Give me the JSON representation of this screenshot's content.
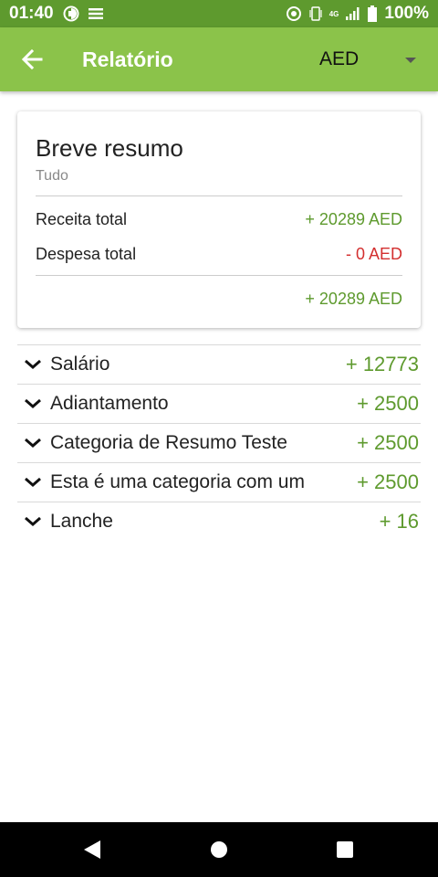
{
  "status_bar": {
    "time": "01:40",
    "battery": "100%",
    "network": "4G",
    "icons": [
      "sim-icon",
      "notification-list-icon",
      "sync-icon",
      "vibrate-icon",
      "signal-icon",
      "battery-icon"
    ]
  },
  "app_bar": {
    "title": "Relatório",
    "currency": "AED",
    "back_icon": "arrow-left-icon",
    "dropdown_icon": "triangle-down-icon"
  },
  "summary": {
    "title": "Breve resumo",
    "subtitle": "Tudo",
    "income_label": "Receita total",
    "income_value": "+ 20289 AED",
    "expense_label": "Despesa total",
    "expense_value": "- 0 AED",
    "balance_value": "+ 20289 AED"
  },
  "categories": [
    {
      "name": "Salário",
      "amount": "+ 12773"
    },
    {
      "name": "Adiantamento",
      "amount": "+ 2500"
    },
    {
      "name": "Categoria de Resumo Teste",
      "amount": "+ 2500"
    },
    {
      "name": "Esta é uma categoria com um",
      "amount": "+ 2500"
    },
    {
      "name": "Lanche",
      "amount": "+ 16"
    }
  ],
  "colors": {
    "status_bar": "#5e9a2e",
    "app_bar": "#8bc34a",
    "positive": "#5e9a2e",
    "negative": "#d32f2f"
  },
  "nav_bar": {
    "icons": [
      "back-triangle-icon",
      "home-circle-icon",
      "recents-square-icon"
    ]
  }
}
